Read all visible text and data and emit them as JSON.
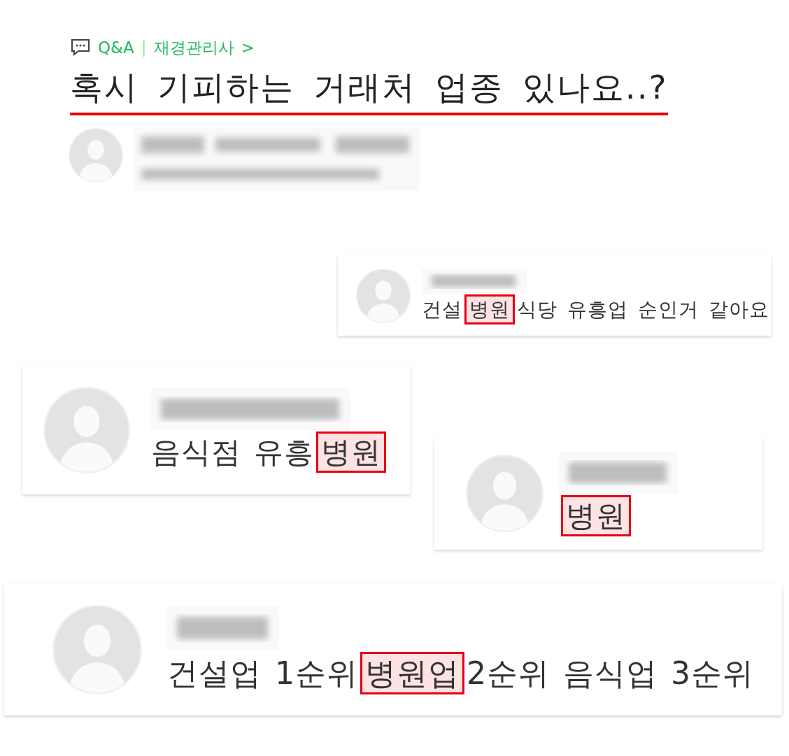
{
  "header": {
    "category": "Q&A",
    "separator": "|",
    "board": "재경관리사",
    "chevron": ">",
    "title": "혹시 기피하는 거래처 업종 있나요..?"
  },
  "comments": [
    {
      "parts": [
        {
          "text": "건설",
          "highlighted": false
        },
        {
          "text": "병원",
          "highlighted": true
        },
        {
          "text": "식당 유흥업 순인거 같아요",
          "highlighted": false
        }
      ]
    },
    {
      "parts": [
        {
          "text": "음식점 유흥",
          "highlighted": false
        },
        {
          "text": "병원",
          "highlighted": true
        }
      ]
    },
    {
      "parts": [
        {
          "text": "병원",
          "highlighted": true
        }
      ]
    },
    {
      "parts": [
        {
          "text": "건설업 1순위",
          "highlighted": false
        },
        {
          "text": "병원업",
          "highlighted": true
        },
        {
          "text": "2순위 음식업 3순위",
          "highlighted": false
        }
      ]
    }
  ]
}
